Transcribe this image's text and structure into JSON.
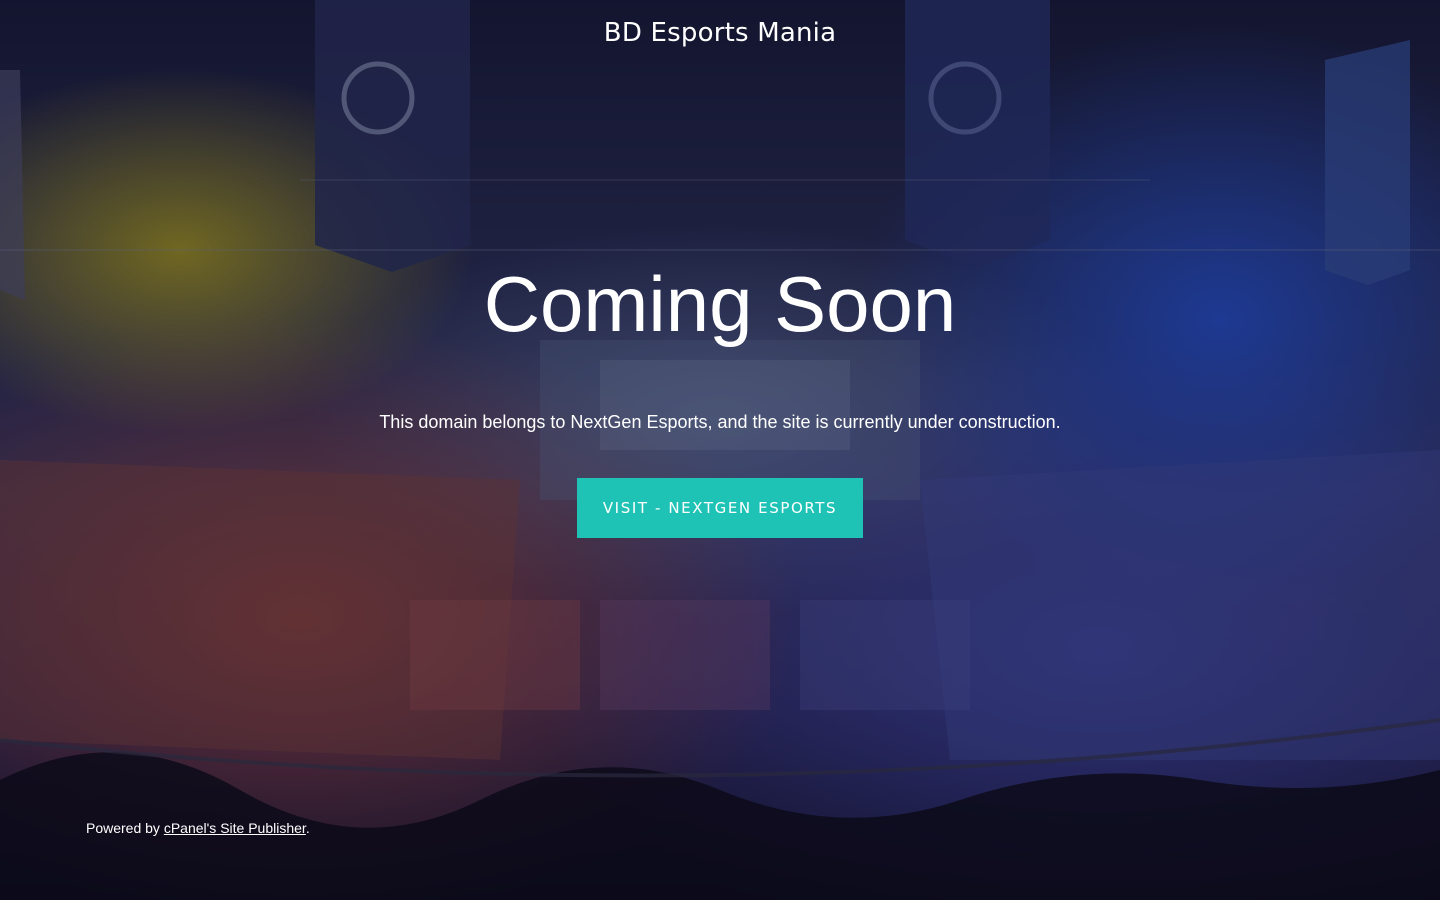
{
  "header": {
    "site_title": "BD Esports Mania"
  },
  "hero": {
    "title": "Coming Soon",
    "description": "This domain belongs to NextGen Esports, and the site is currently under construction.",
    "cta_label": "VISIT - NEXTGEN ESPORTS"
  },
  "footer": {
    "prefix": "Powered by ",
    "link_label": "cPanel's Site Publisher",
    "suffix": "."
  },
  "colors": {
    "button": "#1fc3b6",
    "text": "#ffffff"
  }
}
